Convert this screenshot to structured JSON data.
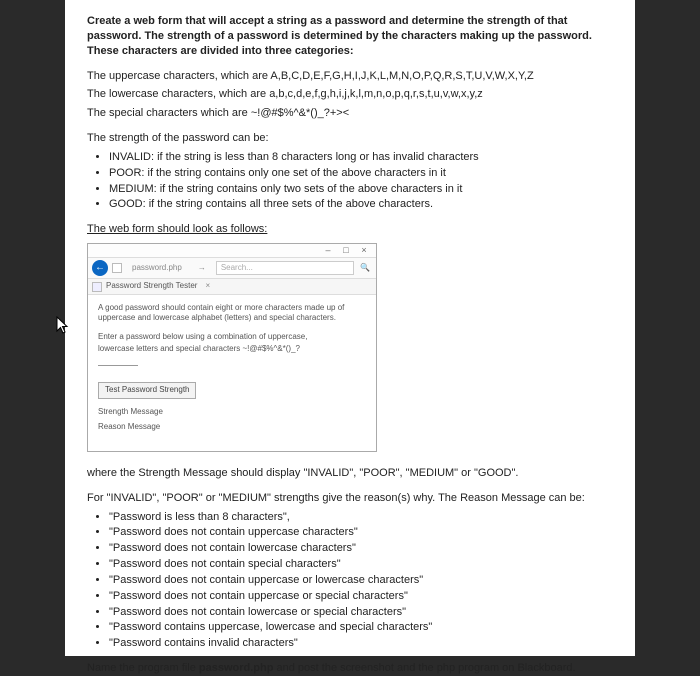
{
  "intro": {
    "p1": "Create a web form that will accept a string as a password and determine the strength of that password. The strength of a password is determined by the characters making up the password. These characters are divided into three categories:",
    "p2": "The uppercase characters, which are A,B,C,D,E,F,G,H,I,J,K,L,M,N,O,P,Q,R,S,T,U,V,W,X,Y,Z",
    "p3": "The lowercase characters, which are a,b,c,d,e,f,g,h,i,j,k,l,m,n,o,p,q,r,s,t,u,v,w,x,y,z",
    "p4": "The special characters which are ~!@#$%^&*()_?+><"
  },
  "strength": {
    "lead": "The strength of the password can be:",
    "items": [
      "INVALID: if the string is less than 8 characters long or has invalid characters",
      "POOR: if the string contains only one set of the above characters in it",
      "MEDIUM: if the string contains only two sets of the above characters in it",
      "GOOD: if the string contains all three sets of the above characters."
    ]
  },
  "formlead": "The web form should look as follows:",
  "window": {
    "min": "–",
    "max": "□",
    "close": "×",
    "addr": "password.php",
    "arrow": "→",
    "search_placeholder": "Search...",
    "search_icon": "🔍",
    "tab_title": "Password Strength Tester",
    "tab_x": "×"
  },
  "form": {
    "desc": "A good password should contain eight or more characters made up of uppercase and lowercase alphabet (letters) and special characters.",
    "label_line1": "Enter a password below using a combination of uppercase,",
    "label_line2": "lowercase letters and special characters ~!@#$%^&*()_?",
    "test_btn": "Test Password Strength",
    "strength_msg": "Strength Message",
    "reason_msg": "Reason Message"
  },
  "where": "where the Strength Message should display \"INVALID\", \"POOR\", \"MEDIUM\" or \"GOOD\".",
  "reasons": {
    "lead": "For \"INVALID\", \"POOR\" or \"MEDIUM\" strengths give the reason(s) why. The Reason Message can be:",
    "items": [
      "\"Password is less than 8 characters\",",
      "\"Password does not contain uppercase characters\"",
      "\"Password does not contain lowercase characters\"",
      "\"Password does not contain special characters\"",
      "\"Password does not contain uppercase or lowercase characters\"",
      "\"Password does not contain uppercase or special characters\"",
      "\"Password does not contain lowercase or special characters\"",
      "\"Password contains uppercase, lowercase and special characters\"",
      "\"Password contains invalid characters\""
    ]
  },
  "footer": {
    "pre": "Name the program file ",
    "file": "password.php",
    "post": " and post the screenshot and the php program on Blackboard."
  }
}
